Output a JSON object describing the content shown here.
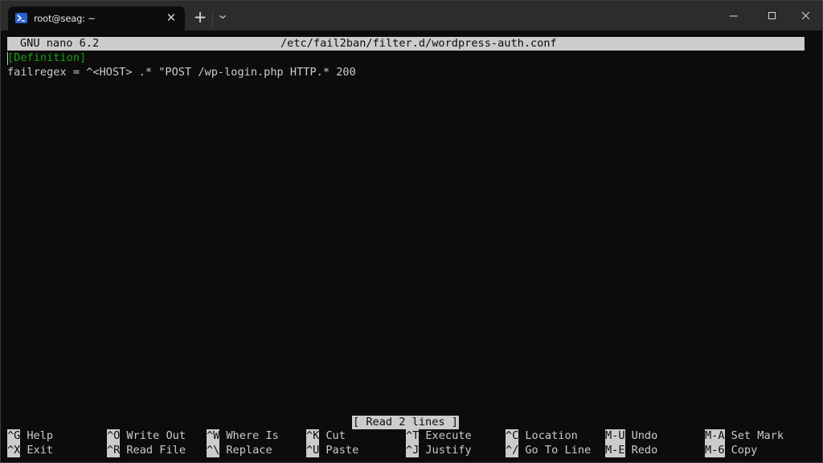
{
  "window": {
    "tab_title": "root@seag: ~",
    "tab_icon": "powershell-icon",
    "controls": {
      "new_tab": "+",
      "close_tab": "✕",
      "minimize": "minimize-icon",
      "maximize": "maximize-icon",
      "close": "close-icon"
    },
    "colors": {
      "titlebar_bg": "#2c2c2c",
      "terminal_bg": "#0c0c0c",
      "text": "#cccccc",
      "section_green": "#13a10e",
      "tab_icon_blue": "#2b5fcf"
    }
  },
  "nano": {
    "version": "GNU nano 6.2",
    "filename": "/etc/fail2ban/filter.d/wordpress-auth.conf",
    "lines": [
      "[Definition]",
      "failregex = ^<HOST> .* \"POST /wp-login.php HTTP.* 200"
    ],
    "status": "[ Read 2 lines ]",
    "shortcuts": [
      [
        {
          "key": "^G",
          "label": "Help"
        },
        {
          "key": "^X",
          "label": "Exit"
        }
      ],
      [
        {
          "key": "^O",
          "label": "Write Out"
        },
        {
          "key": "^R",
          "label": "Read File"
        }
      ],
      [
        {
          "key": "^W",
          "label": "Where Is"
        },
        {
          "key": "^\\",
          "label": "Replace"
        }
      ],
      [
        {
          "key": "^K",
          "label": "Cut"
        },
        {
          "key": "^U",
          "label": "Paste"
        }
      ],
      [
        {
          "key": "^T",
          "label": "Execute"
        },
        {
          "key": "^J",
          "label": "Justify"
        }
      ],
      [
        {
          "key": "^C",
          "label": "Location"
        },
        {
          "key": "^/",
          "label": "Go To Line"
        }
      ],
      [
        {
          "key": "M-U",
          "label": "Undo"
        },
        {
          "key": "M-E",
          "label": "Redo"
        }
      ],
      [
        {
          "key": "M-A",
          "label": "Set Mark"
        },
        {
          "key": "M-6",
          "label": "Copy"
        }
      ]
    ]
  }
}
